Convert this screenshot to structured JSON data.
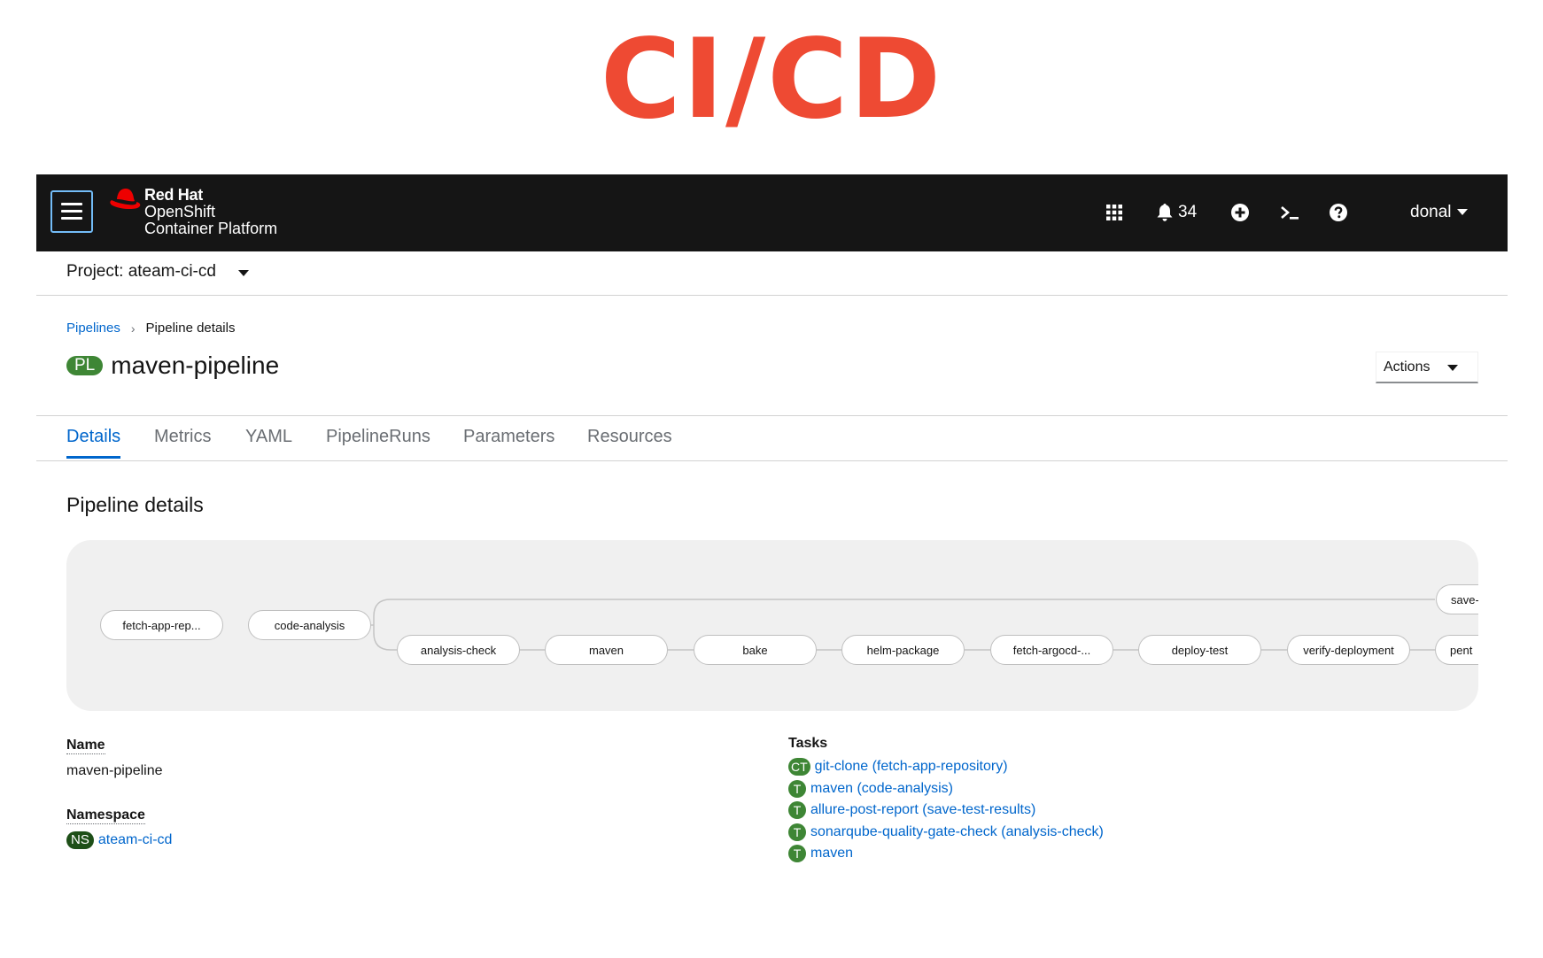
{
  "banner": {
    "title": "CI/CD"
  },
  "masthead": {
    "brand_line1": "Red Hat",
    "brand_line2": "OpenShift",
    "brand_line3": "Container Platform",
    "notification_count": "34",
    "user": "donal",
    "icons": [
      "menu-icon",
      "redhat-logo",
      "app-launcher-icon",
      "bell-icon",
      "plus-circle-icon",
      "terminal-icon",
      "help-icon",
      "caret-down-icon"
    ]
  },
  "project": {
    "label": "Project: ateam-ci-cd"
  },
  "breadcrumb": {
    "parent": "Pipelines",
    "separator": "›",
    "current": "Pipeline details"
  },
  "page": {
    "badge": "PL",
    "title": "maven-pipeline",
    "actions_label": "Actions"
  },
  "tabs": [
    "Details",
    "Metrics",
    "YAML",
    "PipelineRuns",
    "Parameters",
    "Resources"
  ],
  "section": {
    "title": "Pipeline details"
  },
  "pipeline_graph": {
    "nodes": [
      "fetch-app-rep...",
      "code-analysis",
      "save-",
      "analysis-check",
      "maven",
      "bake",
      "helm-package",
      "fetch-argocd-...",
      "deploy-test",
      "verify-deployment",
      "pent"
    ]
  },
  "details": {
    "name_label": "Name",
    "name_value": "maven-pipeline",
    "namespace_label": "Namespace",
    "namespace_badge": "NS",
    "namespace_value": "ateam-ci-cd",
    "tasks_label": "Tasks",
    "tasks": [
      {
        "badge": "CT",
        "text": "git-clone (fetch-app-repository)"
      },
      {
        "badge": "T",
        "text": "maven (code-analysis)"
      },
      {
        "badge": "T",
        "text": "allure-post-report (save-test-results)"
      },
      {
        "badge": "T",
        "text": "sonarqube-quality-gate-check (analysis-check)"
      },
      {
        "badge": "T",
        "text": "maven"
      }
    ]
  },
  "colors": {
    "brand_red": "#ee4a33",
    "masthead_bg": "#151515",
    "link": "#0066cc",
    "badge_green": "#3e8635",
    "ns_badge": "#1e4f18"
  }
}
